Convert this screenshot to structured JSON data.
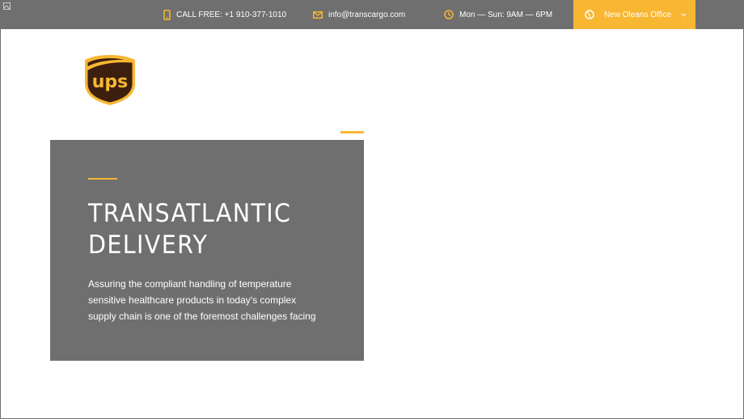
{
  "topbar": {
    "phone": {
      "icon": "phone-icon",
      "text": "CALL FREE: +1 910-377-1010"
    },
    "email": {
      "icon": "envelope-icon",
      "text": "info@transcargo.com"
    },
    "hours": {
      "icon": "clock-icon",
      "text": "Mon — Sun: 9AM — 6PM"
    },
    "office": {
      "icon": "globe-icon",
      "text": "New Oleans Office",
      "chevron": "chevron-down-icon"
    }
  },
  "logo": {
    "text": "ups",
    "shield_color": "#3c1f0e",
    "accent_color": "#f7b733"
  },
  "hero": {
    "title_line1": "TRANSATLANTIC",
    "title_line2": "DELIVERY",
    "description_line1": "Assuring the compliant handling of temperature",
    "description_line2": "sensitive healthcare products in today's complex",
    "description_line3": "supply chain is one of the foremost challenges facing"
  },
  "colors": {
    "accent": "#f7b733",
    "bar": "#6f6f6f",
    "background": "#ffffff"
  }
}
